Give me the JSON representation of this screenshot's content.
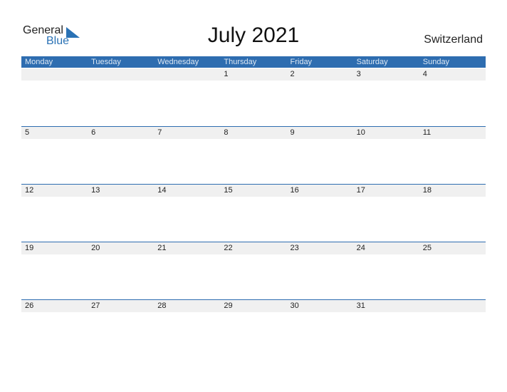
{
  "logo": {
    "general": "General",
    "blue": "Blue"
  },
  "title": "July 2021",
  "country": "Switzerland",
  "days": [
    "Monday",
    "Tuesday",
    "Wednesday",
    "Thursday",
    "Friday",
    "Saturday",
    "Sunday"
  ],
  "weeks": [
    [
      "",
      "",
      "",
      "1",
      "2",
      "3",
      "4"
    ],
    [
      "5",
      "6",
      "7",
      "8",
      "9",
      "10",
      "11"
    ],
    [
      "12",
      "13",
      "14",
      "15",
      "16",
      "17",
      "18"
    ],
    [
      "19",
      "20",
      "21",
      "22",
      "23",
      "24",
      "25"
    ],
    [
      "26",
      "27",
      "28",
      "29",
      "30",
      "31",
      ""
    ]
  ]
}
